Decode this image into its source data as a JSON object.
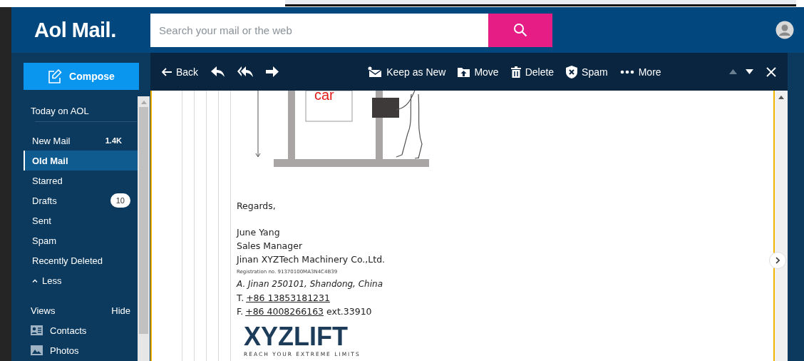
{
  "logo": "Aol Mail.",
  "search": {
    "placeholder": "Search your mail or the web"
  },
  "compose": "Compose",
  "sidebar": {
    "today": "Today on AOL",
    "folders": [
      {
        "label": "New Mail",
        "count": "1.4K",
        "kind": "plain",
        "selected": false
      },
      {
        "label": "Old Mail",
        "selected": true
      },
      {
        "label": "Starred",
        "selected": false
      },
      {
        "label": "Drafts",
        "count": "10",
        "kind": "pill",
        "selected": false
      },
      {
        "label": "Sent",
        "selected": false
      },
      {
        "label": "Spam",
        "selected": false
      },
      {
        "label": "Recently Deleted",
        "selected": false
      }
    ],
    "less": "Less",
    "views": {
      "title": "Views",
      "toggle": "Hide",
      "items": [
        {
          "label": "Contacts"
        },
        {
          "label": "Photos"
        }
      ]
    }
  },
  "toolbar": {
    "back": "Back",
    "actions": [
      {
        "label": "Keep as New"
      },
      {
        "label": "Move"
      },
      {
        "label": "Delete"
      },
      {
        "label": "Spam"
      },
      {
        "label": "More"
      }
    ]
  },
  "email": {
    "diagram_label": "car",
    "closing": "Regards,",
    "signature": [
      {
        "kind": "line",
        "text": "June Yang"
      },
      {
        "kind": "line",
        "text": "Sales Manager"
      },
      {
        "kind": "line",
        "text": "Jinan XYZTech Machinery Co.,Ltd."
      },
      {
        "kind": "small",
        "text": "Registration no. 91370100MA3N4C4B39"
      },
      {
        "kind": "italic",
        "text": "A. Jinan 250101, Shandong, China"
      },
      {
        "kind": "phone",
        "prefix": "T.",
        "number": "+86 13853181231"
      },
      {
        "kind": "phone",
        "prefix": "F.",
        "number": "+86 4008266163",
        "suffix": "ext.33910"
      }
    ],
    "logo": {
      "name": "XYZLIFT",
      "tagline": "REACH YOUR EXTREME LIMITS"
    }
  }
}
